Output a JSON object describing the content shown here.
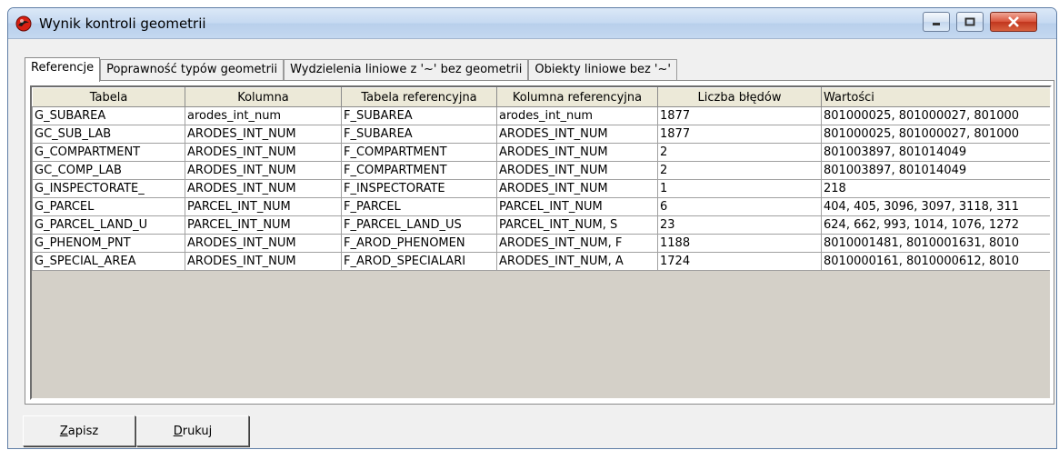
{
  "window": {
    "title": "Wynik kontroli geometrii",
    "controls": {
      "minimize": "minimize-icon",
      "maximize": "maximize-icon",
      "close": "close-icon"
    }
  },
  "tabs": [
    {
      "label": "Referencje",
      "active": true
    },
    {
      "label": "Poprawność typów geometrii",
      "active": false
    },
    {
      "label": "Wydzielenia liniowe z '~' bez geometrii",
      "active": false
    },
    {
      "label": "Obiekty liniowe bez '~'",
      "active": false
    }
  ],
  "table": {
    "columns": [
      "Tabela",
      "Kolumna",
      "Tabela referencyjna",
      "Kolumna referencyjna",
      "Liczba błędów",
      "Wartości"
    ],
    "rows": [
      [
        "G_SUBAREA",
        "arodes_int_num",
        "F_SUBAREA",
        "arodes_int_num",
        "1877",
        "801000025, 801000027, 801000"
      ],
      [
        "GC_SUB_LAB",
        "ARODES_INT_NUM",
        "F_SUBAREA",
        "ARODES_INT_NUM",
        "1877",
        "801000025, 801000027, 801000"
      ],
      [
        "G_COMPARTMENT",
        "ARODES_INT_NUM",
        "F_COMPARTMENT",
        "ARODES_INT_NUM",
        "2",
        "801003897, 801014049"
      ],
      [
        "GC_COMP_LAB",
        "ARODES_INT_NUM",
        "F_COMPARTMENT",
        "ARODES_INT_NUM",
        "2",
        "801003897, 801014049"
      ],
      [
        "G_INSPECTORATE_",
        "ARODES_INT_NUM",
        "F_INSPECTORATE",
        "ARODES_INT_NUM",
        "1",
        "218"
      ],
      [
        "G_PARCEL",
        "PARCEL_INT_NUM",
        "F_PARCEL",
        "PARCEL_INT_NUM",
        "6",
        "404, 405, 3096, 3097, 3118, 311"
      ],
      [
        "G_PARCEL_LAND_U",
        "PARCEL_INT_NUM",
        "F_PARCEL_LAND_US",
        "PARCEL_INT_NUM, S",
        "23",
        "624, 662, 993, 1014, 1076, 1272"
      ],
      [
        "G_PHENOM_PNT",
        "ARODES_INT_NUM",
        "F_AROD_PHENOMEN",
        "ARODES_INT_NUM, F",
        "1188",
        "8010001481, 8010001631, 8010"
      ],
      [
        "G_SPECIAL_AREA",
        "ARODES_INT_NUM",
        "F_AROD_SPECIALARI",
        "ARODES_INT_NUM, A",
        "1724",
        "8010000161, 8010000612, 8010"
      ]
    ]
  },
  "buttons": {
    "save": {
      "mnemonic": "Z",
      "rest": "apisz"
    },
    "print": {
      "mnemonic": "D",
      "rest": "rukuj"
    }
  },
  "colors": {
    "title_bar": "#c4d8f0",
    "close_button": "#c1361e",
    "grid_background": "#d4d0c8"
  }
}
